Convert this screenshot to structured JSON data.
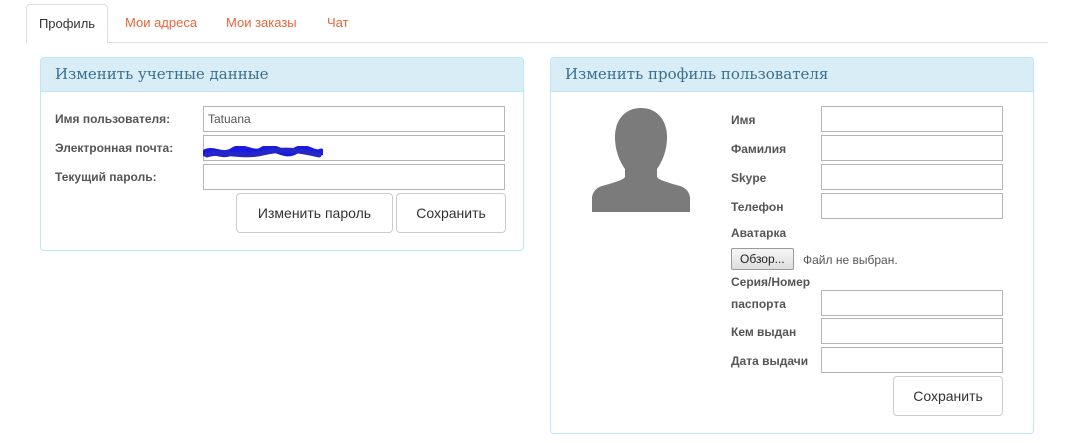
{
  "tabs": [
    {
      "label": "Профиль"
    },
    {
      "label": "Мои адреса"
    },
    {
      "label": "Мои заказы"
    },
    {
      "label": "Чат"
    }
  ],
  "account": {
    "title": "Изменить учетные данные",
    "username_label": "Имя пользователя:",
    "username_value": "Tatuana",
    "email_label": "Электронная почта:",
    "email_value": "",
    "password_label": "Текущий пароль:",
    "change_password_button": "Изменить пароль",
    "save_button": "Сохранить"
  },
  "profile": {
    "title": "Изменить профиль пользователя",
    "avatar_icon": "person-silhouette-icon",
    "first_name_label": "Имя",
    "last_name_label": "Фамилия",
    "skype_label": "Skype",
    "phone_label": "Телефон",
    "avatar_label": "Аватарка",
    "browse_button": "Обзор...",
    "no_file_text": "Файл не выбран.",
    "passport_label_line1": "Серия/Номер",
    "passport_label_line2": "паспорта",
    "issued_by_label": "Кем выдан",
    "issue_date_label": "Дата выдачи",
    "save_button": "Сохранить"
  },
  "colors": {
    "tab_link": "#e8663c",
    "panel_heading_bg": "#d9edf7",
    "panel_border": "#bce8f1",
    "heading_text": "#3a6f8f",
    "redaction": "#1a1ae0"
  }
}
